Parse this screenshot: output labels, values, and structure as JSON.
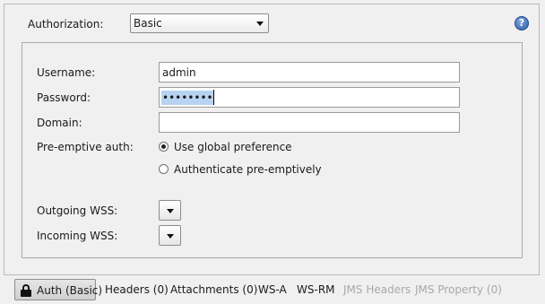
{
  "authorization": {
    "label": "Authorization:",
    "selected": "Basic",
    "help_symbol": "?"
  },
  "fields": {
    "username_label": "Username:",
    "username_value": "admin",
    "password_label": "Password:",
    "password_value": "••••••••",
    "domain_label": "Domain:",
    "domain_value": ""
  },
  "preemptive": {
    "label": "Pre-emptive auth:",
    "options": [
      {
        "label": "Use global preference",
        "selected": true
      },
      {
        "label": "Authenticate pre-emptively",
        "selected": false
      }
    ]
  },
  "wss": {
    "outgoing_label": "Outgoing WSS:",
    "incoming_label": "Incoming WSS:"
  },
  "tabs": [
    {
      "label": "Auth (Basic)",
      "active": true,
      "enabled": true
    },
    {
      "label": "Headers (0)",
      "active": false,
      "enabled": true
    },
    {
      "label": "Attachments (0)",
      "active": false,
      "enabled": true
    },
    {
      "label": "WS-A",
      "active": false,
      "enabled": true
    },
    {
      "label": "WS-RM",
      "active": false,
      "enabled": true
    },
    {
      "label": "JMS Headers",
      "active": false,
      "enabled": false
    },
    {
      "label": "JMS Property (0)",
      "active": false,
      "enabled": false
    }
  ]
}
